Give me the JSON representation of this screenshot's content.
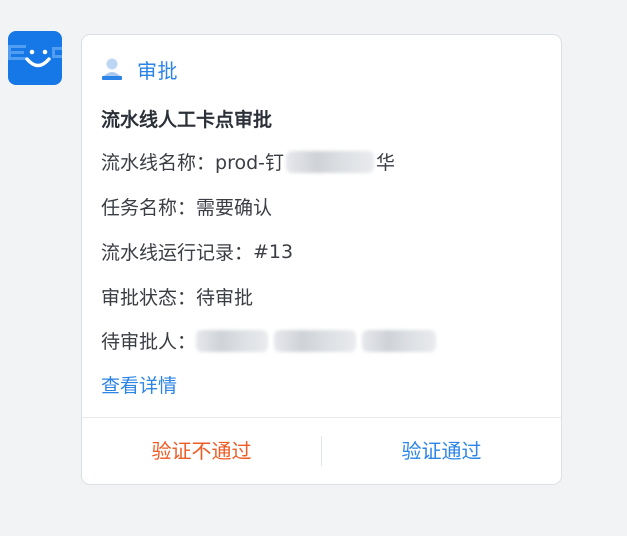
{
  "card": {
    "header_label": "审批",
    "title": "流水线人工卡点审批",
    "fields": [
      {
        "label": "流水线名称：",
        "value": "prod-钉",
        "value_tail": "华"
      },
      {
        "label": "任务名称：",
        "value": "需要确认"
      },
      {
        "label": "流水线运行记录：",
        "value": "#13"
      },
      {
        "label": "审批状态：",
        "value": "待审批"
      },
      {
        "label": "待审批人：",
        "value": ""
      }
    ],
    "detail_link": "查看详情",
    "reject_button": "验证不通过",
    "approve_button": "验证通过"
  },
  "colors": {
    "accent": "#2b84e6",
    "reject": "#f05a23",
    "avatar_bg": "#1677e6"
  },
  "icons": {
    "avatar": "smile-logo-icon",
    "header": "user-icon"
  }
}
